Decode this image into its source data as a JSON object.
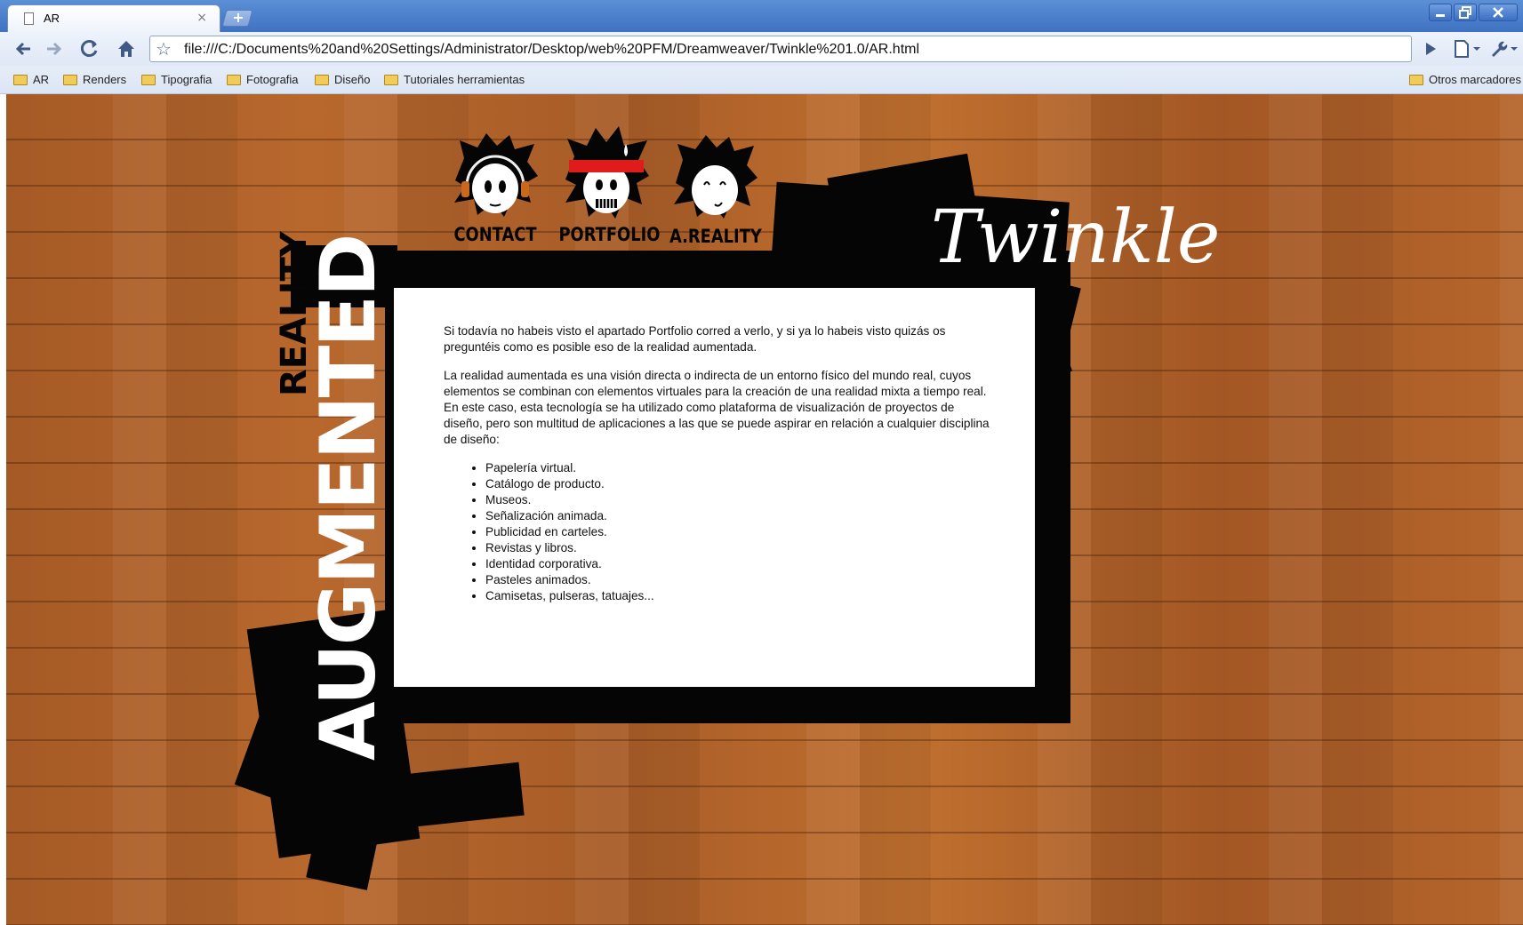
{
  "browser": {
    "tab_title": "AR",
    "tab_close": "×",
    "new_tab": "+",
    "url": "file:///C:/Documents%20and%20Settings/Administrator/Desktop/web%20PFM/Dreamweaver/Twinkle%201.0/AR.html",
    "window_controls": [
      "minimize-icon",
      "restore-icon",
      "close-icon"
    ],
    "nav_icons": [
      "back-icon",
      "forward-icon",
      "reload-icon",
      "home-icon",
      "bookmark-star-icon"
    ],
    "bookmarks": [
      "AR",
      "Renders",
      "Tipografia",
      "Fotografia",
      "Diseño",
      "Tutoriales herramientas"
    ],
    "other_bookmarks": "Otros marcadores"
  },
  "page": {
    "logo": "Twinkle",
    "side_title_main": "AUGMENTED",
    "side_title_sub": "REALITY",
    "nav": [
      {
        "label": "CONTACT",
        "icon": "headphones-face-icon"
      },
      {
        "label": "PORTFOLIO",
        "icon": "headband-face-icon"
      },
      {
        "label": "A.REALITY",
        "icon": "smiling-face-icon"
      }
    ],
    "paragraph_1": "Si todavía no habeis visto el apartado Portfolio corred a verlo, y si ya lo habeis visto quizás os preguntéis como es posible eso de la realidad aumentada.",
    "paragraph_2": "La realidad aumentada es una visión directa o indirecta de un entorno físico del mundo real, cuyos elementos se combinan con elementos virtuales para la creación de una realidad mixta a tiempo real. En este caso, esta tecnología se ha utilizado como plataforma de visualización de proyectos de diseño, pero son multitud de aplicaciones a las que se puede aspirar en relación a cualquier disciplina de diseño:",
    "list": [
      "Papelería virtual.",
      "Catálogo de producto.",
      "Museos.",
      "Señalización animada.",
      "Publicidad en carteles.",
      "Revistas y libros.",
      "Identidad corporativa.",
      "Pasteles animados.",
      "Camisetas, pulseras, tatuajes..."
    ],
    "colors": {
      "wood": "#b0612a",
      "ink": "#050505",
      "panel": "#ffffff",
      "headband": "#e01b1b"
    }
  }
}
